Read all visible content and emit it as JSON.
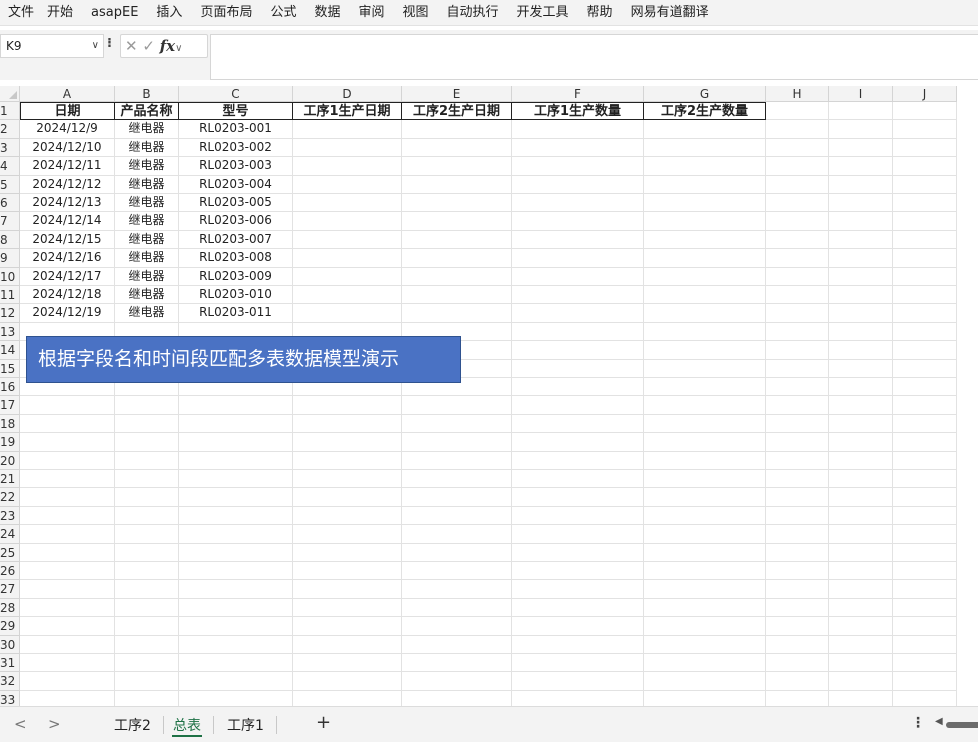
{
  "menu": [
    "文件",
    "开始",
    "asapEE",
    "插入",
    "页面布局",
    "公式",
    "数据",
    "审阅",
    "视图",
    "自动执行",
    "开发工具",
    "帮助",
    "网易有道翻译"
  ],
  "formula_bar": {
    "name_box": "K9",
    "controls_cancel": "✕",
    "controls_enter": "✓",
    "fx": "fx",
    "formula": ""
  },
  "columns": [
    "A",
    "B",
    "C",
    "D",
    "E",
    "F",
    "G",
    "H",
    "I",
    "J"
  ],
  "row_numbers": [
    "1",
    "2",
    "3",
    "4",
    "5",
    "6",
    "7",
    "8",
    "9",
    "10",
    "11",
    "12",
    "13",
    "14",
    "15",
    "16",
    "17",
    "18",
    "19",
    "20",
    "21",
    "22",
    "23",
    "24",
    "25",
    "26",
    "27",
    "28",
    "29",
    "30",
    "31",
    "32",
    "33"
  ],
  "table": {
    "headers": [
      "日期",
      "产品名称",
      "型号",
      "工序1生产日期",
      "工序2生产日期",
      "工序1生产数量",
      "工序2生产数量"
    ],
    "rows": [
      [
        "2024/12/9",
        "继电器",
        "RL0203-001"
      ],
      [
        "2024/12/10",
        "继电器",
        "RL0203-002"
      ],
      [
        "2024/12/11",
        "继电器",
        "RL0203-003"
      ],
      [
        "2024/12/12",
        "继电器",
        "RL0203-004"
      ],
      [
        "2024/12/13",
        "继电器",
        "RL0203-005"
      ],
      [
        "2024/12/14",
        "继电器",
        "RL0203-006"
      ],
      [
        "2024/12/15",
        "继电器",
        "RL0203-007"
      ],
      [
        "2024/12/16",
        "继电器",
        "RL0203-008"
      ],
      [
        "2024/12/17",
        "继电器",
        "RL0203-009"
      ],
      [
        "2024/12/18",
        "继电器",
        "RL0203-010"
      ],
      [
        "2024/12/19",
        "继电器",
        "RL0203-011"
      ]
    ]
  },
  "banner_text": "根据字段名和时间段匹配多表数据模型演示",
  "sheets": {
    "tabs": [
      "工序2",
      "总表",
      "工序1"
    ],
    "active": "总表",
    "add_label": "+",
    "prev": "<",
    "next": ">",
    "more": "⋮"
  },
  "colors": {
    "banner_bg": "#4a72c4",
    "active_tab": "#1e7145"
  }
}
